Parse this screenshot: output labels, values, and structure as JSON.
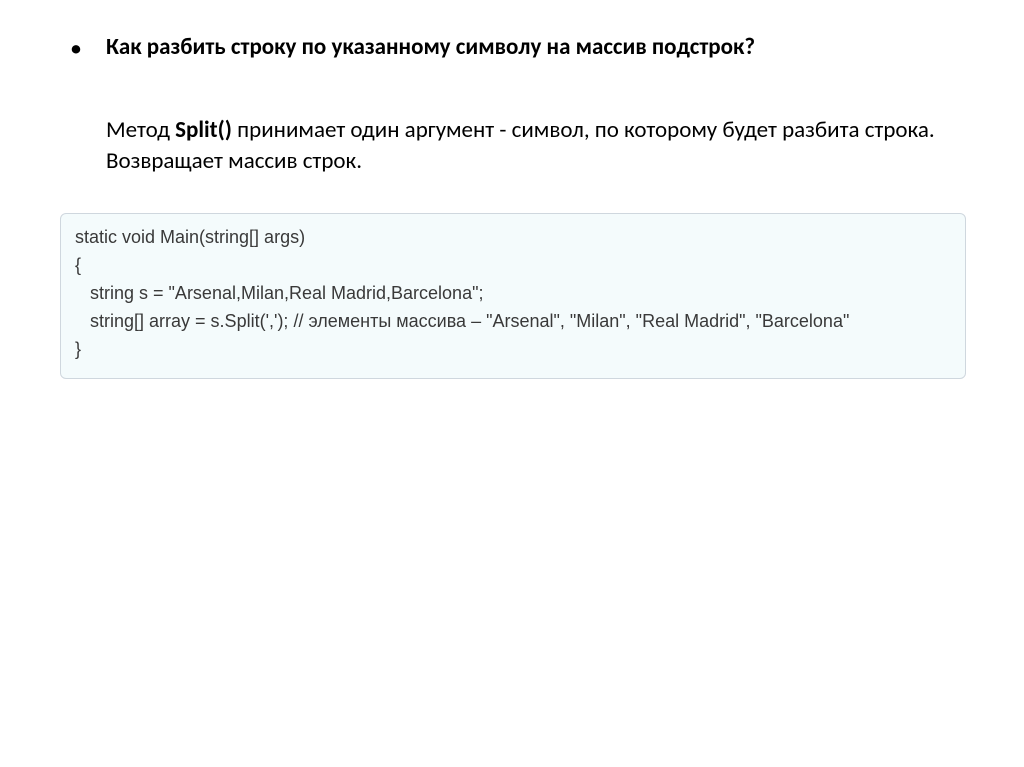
{
  "bullet": "•",
  "question": "Как разбить строку по указанному символу на массив подстрок?",
  "answer_pre": "Метод ",
  "method": "Split()",
  "answer_post": " принимает один аргумент - символ, по которому будет разбита строка. Возвращает массив строк.",
  "code": "static void Main(string[] args)\n{\n   string s = \"Arsenal,Milan,Real Madrid,Barcelona\";\n   string[] array = s.Split(','); // элементы массива – \"Arsenal\", \"Milan\", \"Real Madrid\", \"Barcelona\"\n}"
}
